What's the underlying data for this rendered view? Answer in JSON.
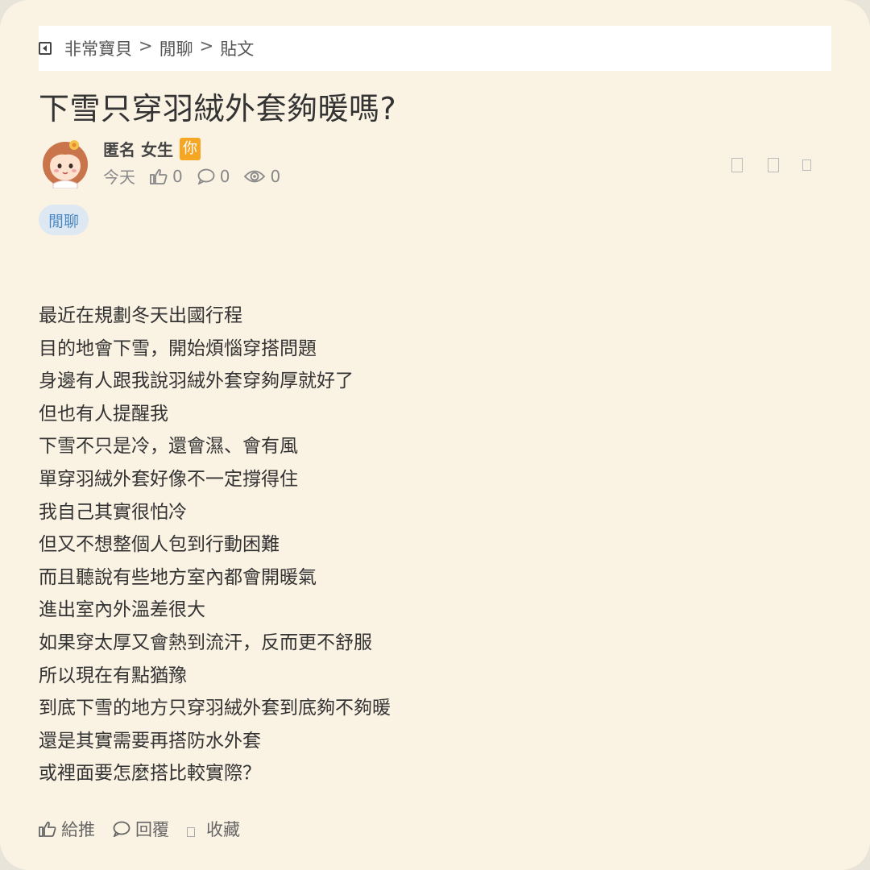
{
  "breadcrumb": {
    "items": [
      "非常寶貝",
      "閒聊",
      "貼文"
    ],
    "separator": ">"
  },
  "post": {
    "title": "下雪只穿羽絨外套夠暖嗎?",
    "author": {
      "name": "匿名 女生",
      "badge": "你"
    },
    "meta": {
      "date": "今天",
      "likes": "0",
      "comments": "0",
      "views": "0"
    },
    "tag": "閒聊",
    "body_lines": [
      "最近在規劃冬天出國行程",
      "目的地會下雪，開始煩惱穿搭問題",
      "身邊有人跟我說羽絨外套穿夠厚就好了",
      "但也有人提醒我",
      "下雪不只是冷，還會濕、會有風",
      "單穿羽絨外套好像不一定撐得住",
      "我自己其實很怕冷",
      "但又不想整個人包到行動困難",
      "而且聽說有些地方室內都會開暖氣",
      "進出室內外溫差很大",
      "如果穿太厚又會熱到流汗，反而更不舒服",
      "所以現在有點猶豫",
      "到底下雪的地方只穿羽絨外套到底夠不夠暖",
      "還是其實需要再搭防水外套",
      "或裡面要怎麼搭比較實際？"
    ]
  },
  "actions": {
    "like": "給推",
    "reply": "回覆",
    "save": "收藏"
  },
  "colors": {
    "background": "#faf2e3",
    "badge": "#f5a623",
    "tag_bg": "#dde8f2",
    "tag_text": "#4a88c4"
  }
}
